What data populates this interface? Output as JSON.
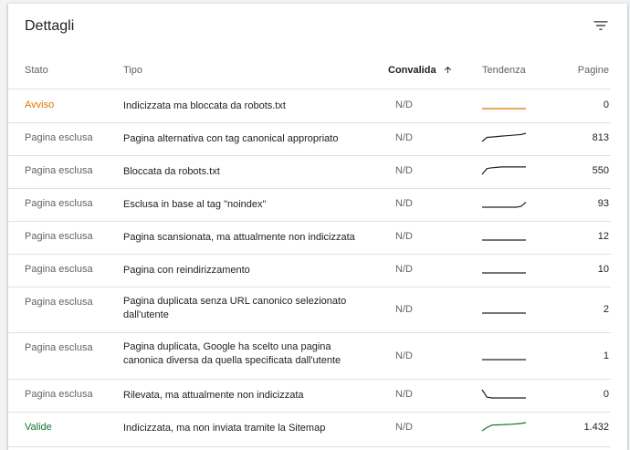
{
  "title": "Dettagli",
  "toolbar": {
    "filter_icon": "filter-list-icon"
  },
  "columns": {
    "stato": "Stato",
    "tipo": "Tipo",
    "convalida": "Convalida",
    "tendenza": "Tendenza",
    "pagine": "Pagine"
  },
  "sort_icon": "arrow-upward-icon",
  "colors": {
    "warning": "#e37400",
    "valid": "#137333",
    "excluded": "#5f6368",
    "trend_excluded": "#202124"
  },
  "rows": [
    {
      "stato": "Avviso",
      "tipo": "Indicizzata ma bloccata da robots.txt",
      "convalida": "N/D",
      "pagine": "0",
      "trend": [
        0,
        0,
        0,
        0,
        0,
        0,
        0,
        0,
        0,
        0
      ]
    },
    {
      "stato": "Pagina esclusa",
      "tipo": "Pagina alternativa con tag canonical appropriato",
      "convalida": "N/D",
      "pagine": "813",
      "trend": [
        0,
        0.5,
        0.55,
        0.6,
        0.65,
        0.7,
        0.75,
        0.8,
        0.85,
        1
      ]
    },
    {
      "stato": "Pagina esclusa",
      "tipo": "Bloccata da robots.txt",
      "convalida": "N/D",
      "pagine": "550",
      "trend": [
        0,
        0.7,
        0.8,
        0.85,
        0.9,
        0.9,
        0.9,
        0.9,
        0.9,
        0.9
      ]
    },
    {
      "stato": "Pagina esclusa",
      "tipo": "Esclusa in base al tag \"noindex\"",
      "convalida": "N/D",
      "pagine": "93",
      "trend": [
        0,
        0,
        0,
        0,
        0,
        0,
        0,
        0,
        0.1,
        0.6
      ]
    },
    {
      "stato": "Pagina esclusa",
      "tipo": "Pagina scansionata, ma attualmente non indicizzata",
      "convalida": "N/D",
      "pagine": "12",
      "trend": [
        0,
        0,
        0,
        0,
        0,
        0,
        0,
        0,
        0,
        0
      ]
    },
    {
      "stato": "Pagina esclusa",
      "tipo": "Pagina con reindirizzamento",
      "convalida": "N/D",
      "pagine": "10",
      "trend": [
        0,
        0,
        0,
        0,
        0,
        0,
        0,
        0,
        0,
        0
      ]
    },
    {
      "stato": "Pagina esclusa",
      "tipo": "Pagina duplicata senza URL canonico selezionato dall'utente",
      "convalida": "N/D",
      "pagine": "2",
      "trend": [
        0,
        0,
        0,
        0,
        0,
        0,
        0,
        0,
        0,
        0
      ]
    },
    {
      "stato": "Pagina esclusa",
      "tipo": "Pagina duplicata, Google ha scelto una pagina canonica diversa da quella specificata dall'utente",
      "convalida": "N/D",
      "pagine": "1",
      "trend": [
        0,
        0,
        0,
        0,
        0,
        0,
        0,
        0,
        0,
        0
      ]
    },
    {
      "stato": "Pagina esclusa",
      "tipo": "Rilevata, ma attualmente non indicizzata",
      "convalida": "N/D",
      "pagine": "0",
      "trend": [
        1,
        0.1,
        0,
        0,
        0,
        0,
        0,
        0,
        0,
        0
      ]
    },
    {
      "stato": "Valide",
      "tipo": "Indicizzata, ma non inviata tramite la Sitemap",
      "convalida": "N/D",
      "pagine": "1.432",
      "trend": [
        0,
        0.4,
        0.7,
        0.72,
        0.75,
        0.78,
        0.8,
        0.85,
        0.9,
        1
      ]
    }
  ]
}
